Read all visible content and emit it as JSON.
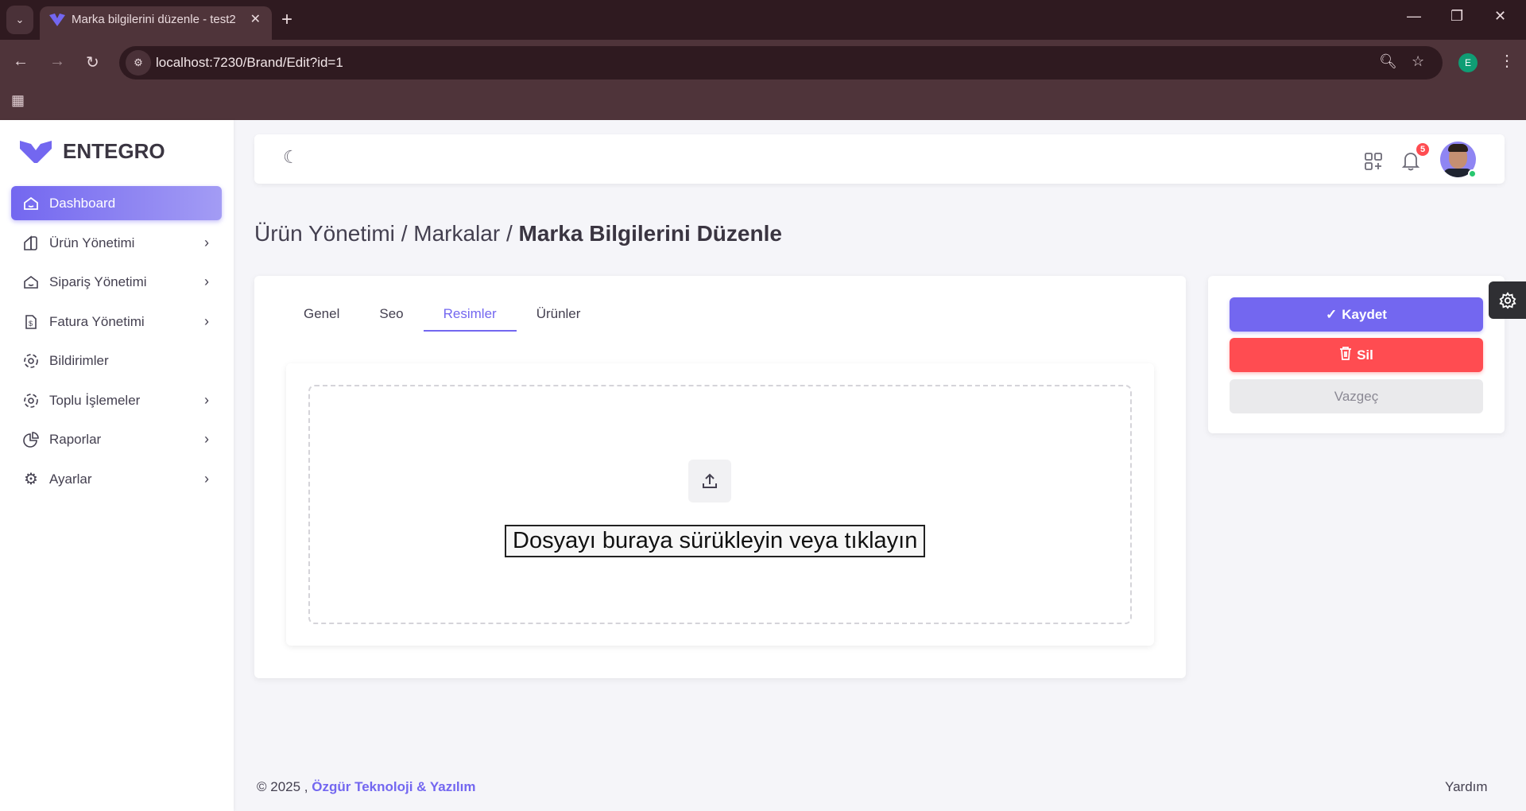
{
  "browser": {
    "tab_title": "Marka bilgilerini düzenle - test2",
    "url": "localhost:7230/Brand/Edit?id=1",
    "profile_initial": "E"
  },
  "sidebar": {
    "brand": "ENTEGRO",
    "items": [
      {
        "label": "Dashboard",
        "icon": "home-icon",
        "active": true
      },
      {
        "label": "Ürün Yönetimi",
        "icon": "product-icon"
      },
      {
        "label": "Sipariş Yönetimi",
        "icon": "order-icon"
      },
      {
        "label": "Fatura Yönetimi",
        "icon": "invoice-icon"
      },
      {
        "label": "Bildirimler",
        "icon": "notification-icon"
      },
      {
        "label": "Toplu İşlemeler",
        "icon": "bulk-icon"
      },
      {
        "label": "Raporlar",
        "icon": "chart-pie-icon"
      },
      {
        "label": "Ayarlar",
        "icon": "gear-icon"
      }
    ]
  },
  "header": {
    "notification_count": "5"
  },
  "breadcrumb": {
    "part1": "Ürün Yönetimi",
    "sep": "/",
    "part2": "Markalar",
    "current": "Marka Bilgilerini Düzenle"
  },
  "tabs": [
    "Genel",
    "Seo",
    "Resimler",
    "Ürünler"
  ],
  "dropzone": {
    "text": "Dosyayı buraya sürükleyin veya tıklayın"
  },
  "actions": {
    "save": "Kaydet",
    "delete": "Sil",
    "cancel": "Vazgeç"
  },
  "colors": {
    "primary": "#7367f0",
    "danger": "#ff4c51"
  },
  "footer": {
    "copyright": "© 2025 ,",
    "company": "Özgür Teknoloji & Yazılım",
    "help": "Yardım"
  }
}
